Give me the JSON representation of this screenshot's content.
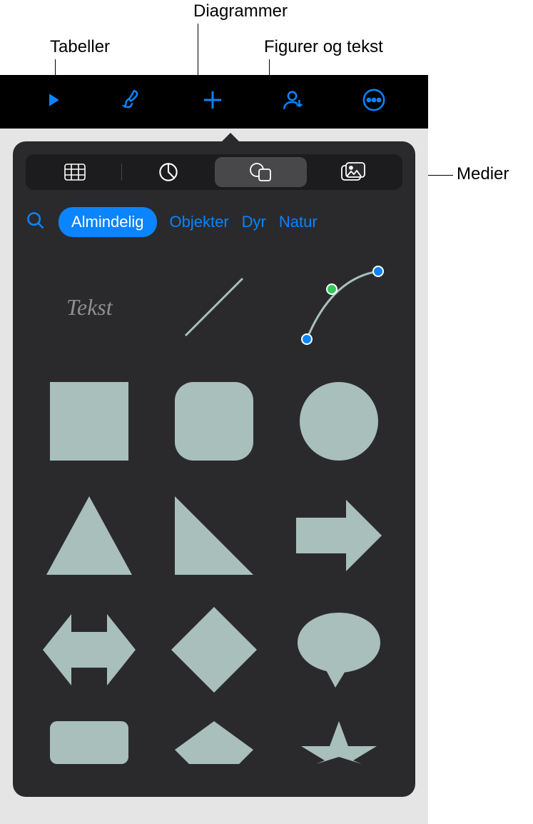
{
  "callouts": {
    "tables": "Tabeller",
    "charts": "Diagrammer",
    "shapes_text": "Figurer og tekst",
    "media": "Medier"
  },
  "categories": {
    "selected": "Almindelig",
    "items": [
      "Almindelig",
      "Objekter",
      "Dyr",
      "Natur"
    ]
  },
  "shapes": {
    "text_label": "Tekst"
  },
  "colors": {
    "accent": "#0a84ff",
    "shape_fill": "#a8bfbb",
    "popover_bg": "#2a2a2c"
  }
}
